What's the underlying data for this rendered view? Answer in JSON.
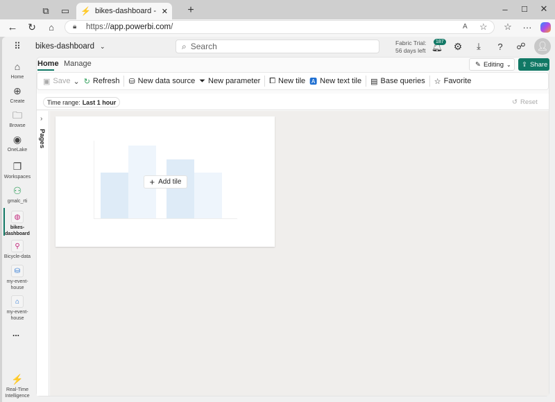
{
  "browser": {
    "tab_title": "bikes-dashboard - Real-Time Intelligence",
    "url_prefix": "https://",
    "url_host": "app.powerbi.com",
    "url_suffix": "/"
  },
  "header": {
    "workspace_item": "bikes-dashboard",
    "search_placeholder": "Search",
    "trial_line1": "Fabric Trial:",
    "trial_line2": "56 days left",
    "notification_count": "187"
  },
  "rail": {
    "items": [
      {
        "label": "Home",
        "icon": "home-icon"
      },
      {
        "label": "Create",
        "icon": "plus-circle-icon"
      },
      {
        "label": "Browse",
        "icon": "folder-icon"
      },
      {
        "label": "OneLake",
        "icon": "onelake-icon"
      },
      {
        "label": "Workspaces",
        "icon": "workspaces-icon"
      },
      {
        "label": "gmalc_rti",
        "icon": "workspace-group-icon"
      },
      {
        "label": "bikes-dashboard",
        "icon": "dashboard-icon"
      },
      {
        "label": "Bicycle-data",
        "icon": "eventstream-icon"
      },
      {
        "label": "my-event-house",
        "icon": "database-icon"
      },
      {
        "label": "my-event-house",
        "icon": "eventhouse-icon"
      }
    ],
    "more": "...",
    "footer": "Real-Time Intelligence"
  },
  "ribbon": {
    "tabs": [
      "Home",
      "Manage"
    ],
    "active_tab": "Home",
    "editing": "Editing",
    "share": "Share",
    "toolbar": {
      "save": "Save",
      "refresh": "Refresh",
      "new_data_source": "New data source",
      "new_parameter": "New parameter",
      "new_tile": "New tile",
      "new_text_tile": "New text tile",
      "base_queries": "Base queries",
      "favorite": "Favorite"
    }
  },
  "filters": {
    "time_range_label": "Time range:",
    "time_range_value": "Last 1 hour",
    "reset": "Reset"
  },
  "pages": {
    "label": "Pages"
  },
  "tile": {
    "add_tile": "Add tile"
  },
  "colors": {
    "accent": "#117865",
    "bar_dark": "#deebf7",
    "bar_light": "#eef5fc"
  }
}
